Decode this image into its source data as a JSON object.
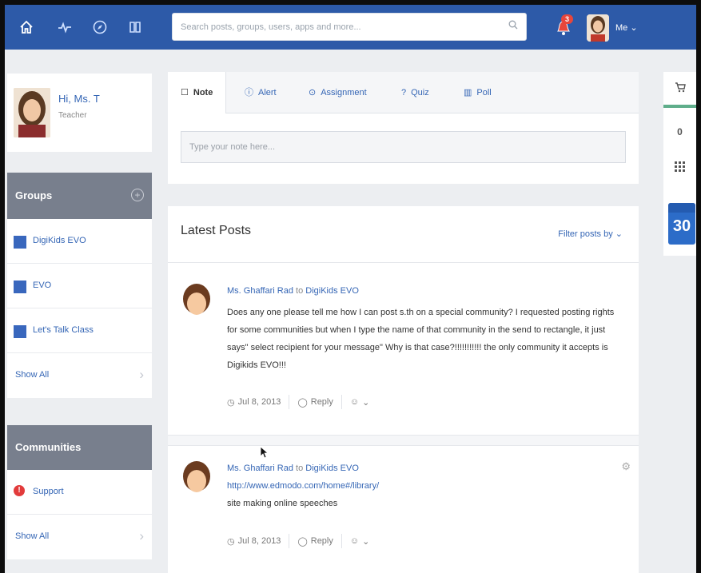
{
  "colors": {
    "nav_bg": "#2d5aa8",
    "link": "#3566b5",
    "panel_head": "#787f8d",
    "group_square": "#3967bd",
    "alert": "#e23b3b",
    "calendar": "#2c6cc8"
  },
  "nav": {
    "icons": [
      "home-icon",
      "activity-icon",
      "compass-icon",
      "library-icon"
    ],
    "search_placeholder": "Search posts, groups, users, apps and more...",
    "notification_count": "3",
    "me_label": "Me"
  },
  "profile": {
    "greeting": "Hi, Ms. T",
    "role": "Teacher"
  },
  "groups": {
    "heading": "Groups",
    "items": [
      {
        "label": "DigiKids EVO"
      },
      {
        "label": "EVO"
      },
      {
        "label": "Let's Talk Class"
      }
    ],
    "show_all": "Show All"
  },
  "communities": {
    "heading": "Communities",
    "items": [
      {
        "label": "Support"
      }
    ],
    "show_all": "Show All"
  },
  "composer": {
    "tabs": [
      {
        "label": "Note",
        "icon": "note-icon",
        "active": true
      },
      {
        "label": "Alert",
        "icon": "alert-icon"
      },
      {
        "label": "Assignment",
        "icon": "assignment-icon"
      },
      {
        "label": "Quiz",
        "icon": "quiz-icon"
      },
      {
        "label": "Poll",
        "icon": "poll-icon"
      }
    ],
    "placeholder": "Type your note here..."
  },
  "posts": {
    "title": "Latest Posts",
    "filter_label": "Filter posts by",
    "items": [
      {
        "author": "Ms. Ghaffari Rad",
        "to_word": "to",
        "target": "DigiKids EVO",
        "body": "Does any one please tell me how I can post s.th on a special community? I requested posting rights for some communities but when I type the name of that community in the send to rectangle, it just says\" select recipient for your message\" Why is that case?!!!!!!!!!!! the only community it accepts is Digikids EVO!!!",
        "date": "Jul 8, 2013",
        "reply": "Reply"
      },
      {
        "author": "Ms. Ghaffari Rad",
        "to_word": "to",
        "target": "DigiKids EVO",
        "link": "http://www.edmodo.com/home#/library/",
        "desc": "site making online speeches",
        "date": "Jul 8, 2013",
        "reply": "Reply"
      }
    ]
  },
  "rail": {
    "badge": "0",
    "calendar_day": "30",
    "icons": [
      "cart-icon",
      "coin-icon",
      "apps-grid-icon",
      "calendar-icon"
    ]
  }
}
